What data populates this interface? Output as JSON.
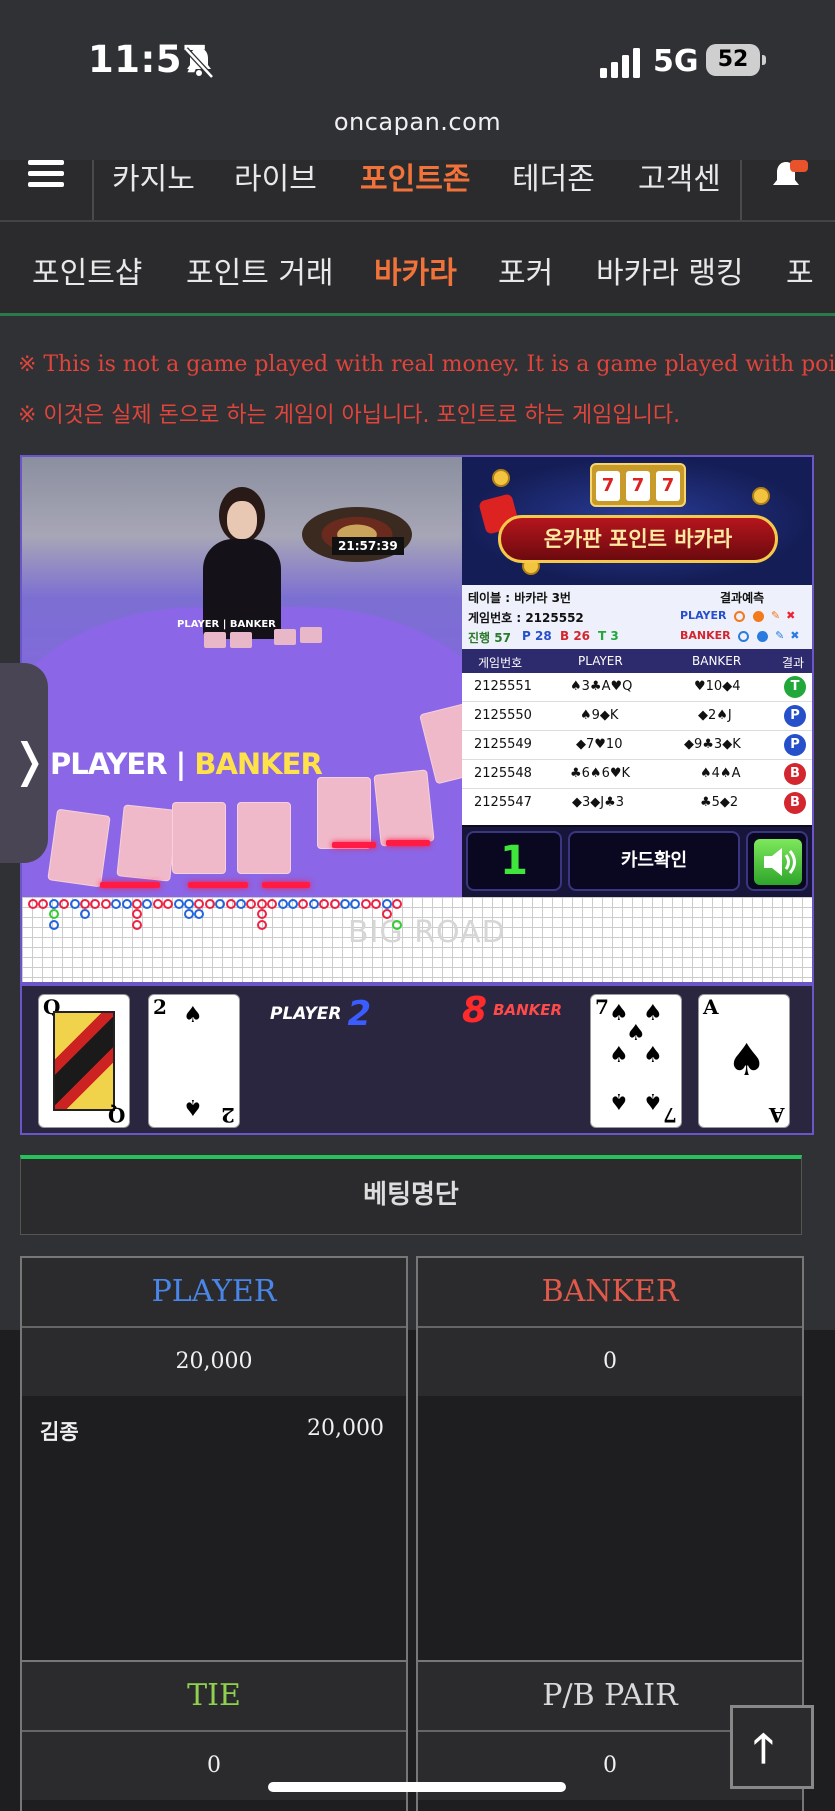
{
  "status": {
    "time": "11:57",
    "network": "5G",
    "battery": "52"
  },
  "url": "oncapan.com",
  "topnav": {
    "items": [
      "카지노",
      "라이브",
      "포인트존",
      "테더존",
      "고객센"
    ],
    "active": "포인트존"
  },
  "subnav": {
    "items": [
      "포인트샵",
      "포인트 거래",
      "바카라",
      "포커",
      "바카라 랭킹",
      "포"
    ],
    "active": "바카라"
  },
  "notice": {
    "en": "※ This is not a game played with real money. It is a game played with points.",
    "ko": "※ 이것은 실제 돈으로 하는 게임이 아닙니다. 포인트로 하는 게임입니다."
  },
  "video": {
    "clock": "21:57:39",
    "table_label": "PLAYER | BANKER",
    "player_label": "PLAYER",
    "banker_label": "BANKER"
  },
  "banner": {
    "title": "온카판 포인트 바카라",
    "slot": [
      "7",
      "7",
      "7"
    ]
  },
  "info": {
    "table": "테이블 : 바카라 3번",
    "game_no": "게임번호 : 2125552",
    "progress": "진행 57",
    "p": "P 28",
    "b": "B 26",
    "t": "T 3",
    "prediction_title": "결과예측",
    "pred_player": "PLAYER",
    "pred_banker": "BANKER"
  },
  "history": {
    "headers": [
      "게임번호",
      "PLAYER",
      "BANKER",
      "결과"
    ],
    "rows": [
      {
        "no": "2125551",
        "player": "♠3♣A♥Q",
        "banker": "♥10◆4",
        "result": "T",
        "color": "#22a83a"
      },
      {
        "no": "2125550",
        "player": "♠9◆K",
        "banker": "◆2♠J",
        "result": "P",
        "color": "#2650c9"
      },
      {
        "no": "2125549",
        "player": "◆7♥10",
        "banker": "◆9♣3◆K",
        "result": "P",
        "color": "#2650c9"
      },
      {
        "no": "2125548",
        "player": "♣6♠6♥K",
        "banker": "♠4♠A",
        "result": "B",
        "color": "#d3262e"
      },
      {
        "no": "2125547",
        "player": "◆3◆J♣3",
        "banker": "♣5◆2",
        "result": "B",
        "color": "#d3262e"
      }
    ]
  },
  "controls": {
    "count": "1",
    "card_check": "카드확인"
  },
  "roads": {
    "label": "BIG ROAD"
  },
  "cards": {
    "player_label": "PLAYER",
    "player_score": "2",
    "banker_label": "BANKER",
    "banker_score": "8",
    "player_cards": [
      {
        "rank": "Q",
        "suit": "♠"
      },
      {
        "rank": "2",
        "suit": "♠"
      }
    ],
    "banker_cards": [
      {
        "rank": "7",
        "suit": "♠"
      },
      {
        "rank": "A",
        "suit": "♠"
      }
    ]
  },
  "betlist": {
    "title": "베팅명단"
  },
  "bets": {
    "player": {
      "label": "PLAYER",
      "amount": "20,000",
      "color": "#4a86e8"
    },
    "banker": {
      "label": "BANKER",
      "amount": "0",
      "color": "#e0594a"
    },
    "tie": {
      "label": "TIE",
      "amount": "0",
      "color": "#8fd14f"
    },
    "pair": {
      "label": "P/B PAIR",
      "amount": "0",
      "color": "#d9d9d9"
    },
    "bettors": [
      {
        "name": "김종",
        "amount": "20,000"
      }
    ]
  }
}
